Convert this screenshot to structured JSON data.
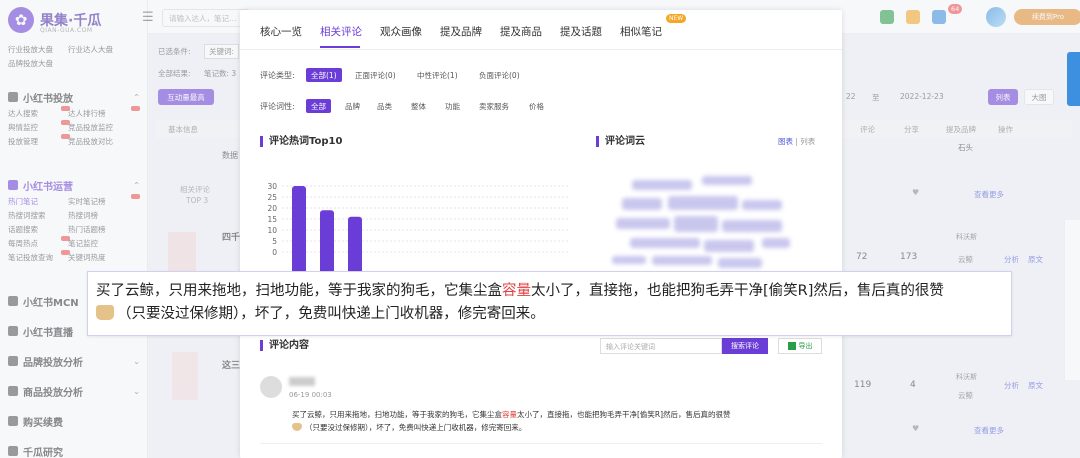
{
  "app": {
    "logo_text": "果集·千瓜",
    "logo_sub": "QIAN-GUA.COM",
    "search_placeholder": "请输入达人，笔记…",
    "notif_count": "64",
    "vip_label": "续费到Pro"
  },
  "sidebar": {
    "top_links": [
      "行业投放大盘",
      "行业达人大盘",
      "品牌投放大盘"
    ],
    "groups": [
      {
        "title": "小红书投放",
        "items": [
          "达人搜索",
          "达人排行榜",
          "舆情监控",
          "竞品投放监控",
          "投放管理",
          "竞品投放对比"
        ]
      },
      {
        "title": "小红书运营",
        "items": [
          "热门笔记",
          "实时笔记榜",
          "热搜词搜索",
          "热搜词榜",
          "话题搜索",
          "热门话题榜",
          "每周热点",
          "笔记监控",
          "笔记投放查询",
          "关键词热度"
        ]
      },
      {
        "title": "小红书MCN",
        "items": []
      },
      {
        "title": "小红书直播",
        "items": []
      },
      {
        "title": "品牌投放分析",
        "items": []
      },
      {
        "title": "商品投放分析",
        "items": []
      },
      {
        "title": "购买续费",
        "items": []
      },
      {
        "title": "千瓜研究",
        "items": []
      }
    ]
  },
  "background": {
    "filter_selected_label": "已选条件:",
    "filter_keyword": "关键词:",
    "result_label": "全部结果:",
    "result_count": "笔记数: 3",
    "tab_interactive": "互动量最高",
    "date_from": "22",
    "date_to_label": "至",
    "date_to": "2022-12-23",
    "view_list": "列表",
    "view_big": "大图",
    "col_basic": "基本信息",
    "col_comments": "评论",
    "col_shares": "分享",
    "col_brand": "提及品牌",
    "col_actions": "操作",
    "row1_label": "数据",
    "row1_top_label": "相关评论",
    "row1_top": "TOP 3",
    "row1_brand": "石头",
    "row1_more": "查看更多",
    "row2_title": "四千",
    "row2_comments": "72",
    "row2_shares": "173",
    "row2_brand_a": "科沃斯",
    "row2_brand_b": "云鲸",
    "row2_analyze": "分析",
    "row2_original": "原文",
    "row3_title": "这三",
    "row3_comments": "119",
    "row3_shares": "4",
    "row3_brand_a": "科沃斯",
    "row3_brand_b": "云鲸",
    "row3_analyze": "分析",
    "row3_original": "原文",
    "row3_more": "查看更多"
  },
  "modal": {
    "tabs": [
      "核心一览",
      "相关评论",
      "观众画像",
      "提及品牌",
      "提及商品",
      "提及话题",
      "相似笔记"
    ],
    "active_tab": 1,
    "new_badge": "NEW",
    "type_label": "评论类型:",
    "type_chips": [
      "全部(1)",
      "正面评论(0)",
      "中性评论(1)",
      "负面评论(0)"
    ],
    "attr_label": "评论词性:",
    "attr_chips": [
      "全部",
      "品牌",
      "品类",
      "整体",
      "功能",
      "卖家服务",
      "价格"
    ],
    "hot_title": "评论热词Top10",
    "cloud_title": "评论词云",
    "cloud_toggle_chart": "图表",
    "cloud_toggle_list": "列表",
    "content_title": "评论内容",
    "comment_search_placeholder": "输入评论关键词",
    "comment_search_button": "搜索评论",
    "export_button": "导出",
    "comment": {
      "time": "06-19 00:03",
      "text_before": "买了云鲸，只用来拖地，扫地功能，等于我家的狗毛，它集尘盒",
      "text_highlight": "容量",
      "text_after": "太小了，直接拖，也能把狗毛弄干净[偷笑R]然后，售后真的很赞",
      "text_line2": "（只要没过保修期），坏了，免费叫快递上门收机器，修完寄回来。"
    }
  },
  "callout": {
    "text_before": "买了云鲸，只用来拖地，扫地功能，等于我家的狗毛，它集尘盒",
    "text_highlight": "容量",
    "text_after": "太小了，直接拖，也能把狗毛弄干净[偷笑R]然后，售后真的很赞",
    "text_line2": "（只要没过保修期），坏了，免费叫快递上门收机器，修完寄回来。"
  },
  "colors": {
    "accent": "#6a3dd6",
    "highlight": "#e04040",
    "vip": "#e58d2a"
  },
  "chart_data": {
    "type": "bar",
    "title": "评论热词Top10",
    "ylim": [
      0,
      30
    ],
    "yticks": [
      0,
      5,
      10,
      15,
      20,
      25,
      30
    ],
    "values": [
      30,
      19,
      16
    ]
  }
}
